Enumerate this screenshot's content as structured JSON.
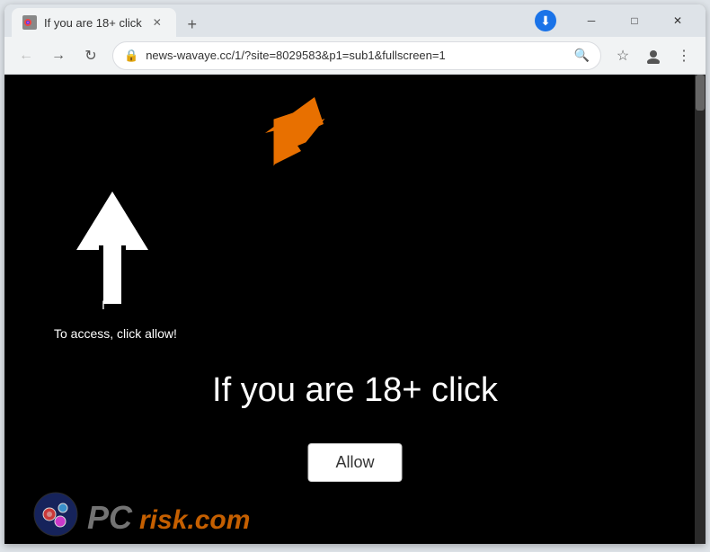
{
  "browser": {
    "tab": {
      "title": "If you are 18+ click",
      "favicon": "🔴"
    },
    "new_tab_label": "+",
    "window_controls": {
      "minimize": "─",
      "maximize": "□",
      "close": "✕"
    },
    "nav": {
      "back_arrow": "←",
      "forward_arrow": "→",
      "reload": "↻",
      "url": "news-wavaye.cc/1/?site=8029583&p1=sub1&fullscreen=1",
      "search_icon": "🔍",
      "bookmark_icon": "☆",
      "profile_icon": "👤",
      "menu_icon": "⋮"
    }
  },
  "page": {
    "instruction_text": "To access, click allow!",
    "main_heading": "If you are 18+ click",
    "allow_button_label": "Allow",
    "watermark": {
      "pc": "PC",
      "risk": "risk",
      "domain": ".com"
    }
  }
}
